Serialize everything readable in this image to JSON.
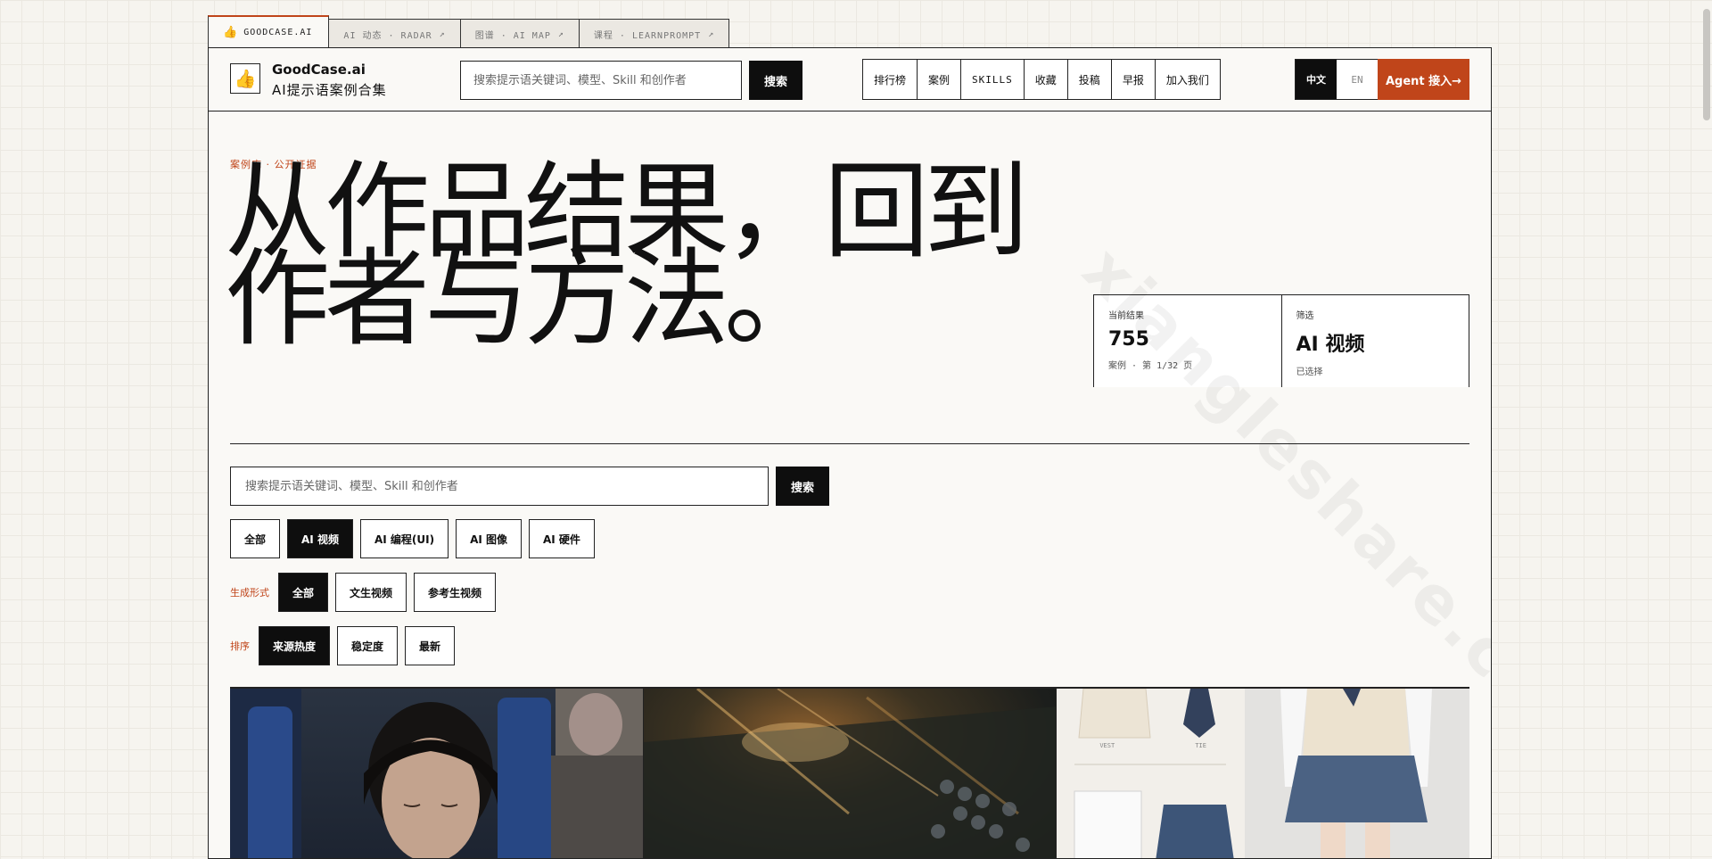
{
  "tabs": [
    {
      "icon": "👍",
      "label": "GOODCASE.AI",
      "ext": ""
    },
    {
      "icon": "",
      "label": "AI 动态 · RADAR",
      "ext": "↗"
    },
    {
      "icon": "",
      "label": "图谱 · AI MAP",
      "ext": "↗"
    },
    {
      "icon": "",
      "label": "课程 · LEARNPROMPT",
      "ext": "↗"
    }
  ],
  "brand": {
    "logo": "👍",
    "name": "GoodCase.ai",
    "subtitle": "AI提示语案例合集"
  },
  "header_search": {
    "placeholder": "搜索提示语关键词、模型、Skill 和创作者",
    "button": "搜索"
  },
  "nav": [
    "排行榜",
    "案例",
    "SKILLS",
    "收藏",
    "投稿",
    "早报",
    "加入我们"
  ],
  "lang": {
    "zh": "中文",
    "en": "EN"
  },
  "agent_button": "Agent 接入→",
  "eyebrow": "案例库 · 公开证据",
  "headline": {
    "line1": "从作品结果，回到",
    "line2": "作者与方法。"
  },
  "stats": [
    {
      "label": "当前结果",
      "value": "755",
      "note": "案例 · 第 1/32 页"
    },
    {
      "label": "筛选",
      "value": "AI 视频",
      "note": "已选择"
    }
  ],
  "main_search": {
    "placeholder": "搜索提示语关键词、模型、Skill 和创作者",
    "button": "搜索"
  },
  "categories": [
    {
      "label": "全部",
      "active": false
    },
    {
      "label": "AI 视频",
      "active": true
    },
    {
      "label": "AI 编程(UI)",
      "active": false
    },
    {
      "label": "AI 图像",
      "active": false
    },
    {
      "label": "AI 硬件",
      "active": false
    }
  ],
  "generation": {
    "label": "生成形式",
    "options": [
      {
        "label": "全部",
        "active": true
      },
      {
        "label": "文生视频",
        "active": false
      },
      {
        "label": "参考生视频",
        "active": false
      }
    ]
  },
  "sort": {
    "label": "排序",
    "options": [
      {
        "label": "来源热度",
        "active": true
      },
      {
        "label": "稳定度",
        "active": false
      },
      {
        "label": "最新",
        "active": false
      }
    ]
  },
  "card3_labels": {
    "vest": "VEST",
    "tie": "TIE"
  },
  "watermark": "xiangleshare.com",
  "colors": {
    "accent": "#c0451a",
    "ink": "#0e0e0e",
    "paper": "#faf9f6"
  }
}
